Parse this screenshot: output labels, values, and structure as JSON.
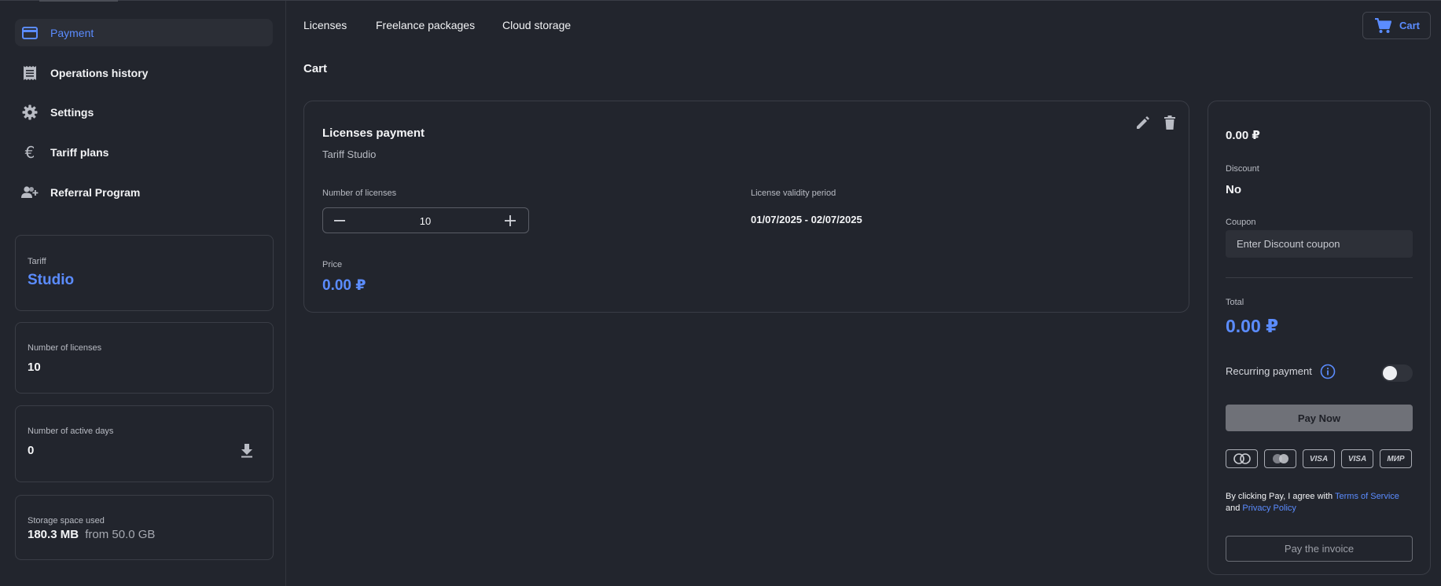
{
  "sidebar": {
    "items": [
      {
        "label": "Payment",
        "icon": "credit-card-icon"
      },
      {
        "label": "Operations history",
        "icon": "receipt-icon"
      },
      {
        "label": "Settings",
        "icon": "gear-icon"
      },
      {
        "label": "Tariff plans",
        "icon": "euro-icon"
      },
      {
        "label": "Referral Program",
        "icon": "add-user-icon"
      }
    ],
    "tariff": {
      "caption": "Tariff",
      "value": "Studio"
    },
    "licenses": {
      "caption": "Number of licenses",
      "value": "10"
    },
    "active_days": {
      "caption": "Number of active days",
      "value": "0"
    },
    "storage": {
      "caption": "Storage space used",
      "value": "180.3 MB",
      "from": "from 50.0 GB"
    }
  },
  "tabs": [
    "Licenses",
    "Freelance packages",
    "Cloud storage"
  ],
  "cart_button": {
    "label": "Cart"
  },
  "page_title": "Cart",
  "item": {
    "title": "Licenses payment",
    "subtitle": "Tariff Studio",
    "licenses_caption": "Number of licenses",
    "licenses_value": "10",
    "validity_caption": "License validity period",
    "validity_value": "01/07/2025 - 02/07/2025",
    "price_caption": "Price",
    "price_value": "0.00 ₽"
  },
  "summary": {
    "amount": "0.00 ₽",
    "discount_caption": "Discount",
    "discount_value": "No",
    "coupon_caption": "Coupon",
    "coupon_placeholder": "Enter Discount coupon",
    "total_caption": "Total",
    "total_value": "0.00 ₽",
    "recurring_label": "Recurring payment",
    "recurring_enabled": false,
    "pay_button": "Pay Now",
    "payment_cards": [
      "MasterCard",
      "Maestro",
      "VISA",
      "VISA",
      "МИР"
    ],
    "agree_text": "By clicking Pay, I agree with",
    "terms_link": "Terms of Service",
    "and_text": "and",
    "privacy_link": "Privacy Policy",
    "invoice_button": "Pay the invoice"
  },
  "colors": {
    "background": "#22252d",
    "accent": "#5b8cff",
    "border": "#3a3d46"
  }
}
